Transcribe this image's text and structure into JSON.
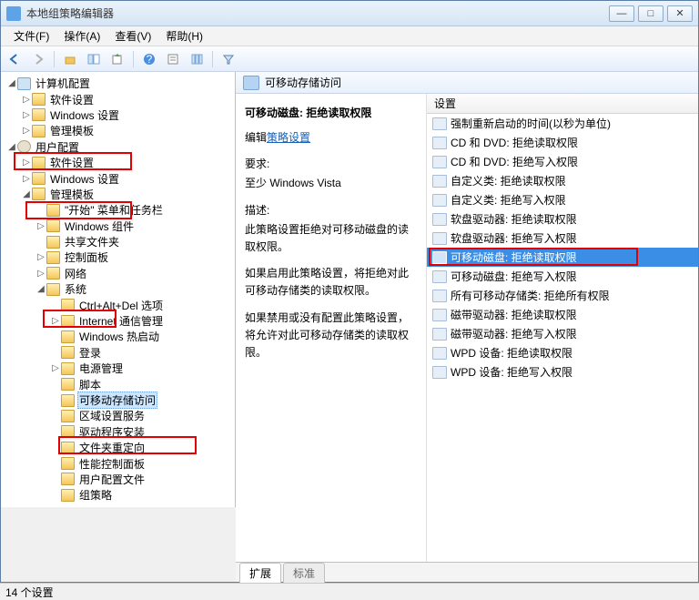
{
  "window": {
    "title": "本地组策略编辑器"
  },
  "menu": {
    "file": "文件(F)",
    "action": "操作(A)",
    "view": "查看(V)",
    "help": "帮助(H)"
  },
  "toolbar_icons": [
    "back",
    "forward",
    "up",
    "show-hide-tree",
    "export",
    "refresh",
    "help",
    "properties",
    "columns",
    "filter"
  ],
  "tree": {
    "root": "计算机配置",
    "n1": "软件设置",
    "n2": "Windows 设置",
    "n3": "管理模板",
    "user_root": "用户配置",
    "u1": "软件设置",
    "u2": "Windows 设置",
    "u3": "管理模板",
    "u3a": "\"开始\" 菜单和任务栏",
    "u3b": "Windows 组件",
    "u3c": "共享文件夹",
    "u3d": "控制面板",
    "u3e": "网络",
    "u3f": "系统",
    "s1": "Ctrl+Alt+Del 选项",
    "s2": "Internet 通信管理",
    "s3": "Windows 热启动",
    "s4": "登录",
    "s5": "电源管理",
    "s6": "脚本",
    "s7": "可移动存储访问",
    "s8": "区域设置服务",
    "s9": "驱动程序安装",
    "s10": "文件夹重定向",
    "s11": "性能控制面板",
    "s12": "用户配置文件",
    "s13": "组策略"
  },
  "pathbar": {
    "title": "可移动存储访问"
  },
  "detail": {
    "title": "可移动磁盘: 拒绝读取权限",
    "edit_label": "编辑",
    "policy_link": "策略设置",
    "req_label": "要求:",
    "req_value": "至少 Windows Vista",
    "desc_label": "描述:",
    "desc1": "此策略设置拒绝对可移动磁盘的读取权限。",
    "desc2": "如果启用此策略设置，将拒绝对此可移动存储类的读取权限。",
    "desc3": "如果禁用或没有配置此策略设置，将允许对此可移动存储类的读取权限。"
  },
  "list": {
    "header": "设置",
    "items": [
      "强制重新启动的时间(以秒为单位)",
      "CD 和 DVD: 拒绝读取权限",
      "CD 和 DVD: 拒绝写入权限",
      "自定义类: 拒绝读取权限",
      "自定义类: 拒绝写入权限",
      "软盘驱动器: 拒绝读取权限",
      "软盘驱动器: 拒绝写入权限",
      "可移动磁盘: 拒绝读取权限",
      "可移动磁盘: 拒绝写入权限",
      "所有可移动存储类: 拒绝所有权限",
      "磁带驱动器: 拒绝读取权限",
      "磁带驱动器: 拒绝写入权限",
      "WPD 设备: 拒绝读取权限",
      "WPD 设备: 拒绝写入权限"
    ],
    "selected_index": 7
  },
  "tabs": {
    "extended": "扩展",
    "standard": "标准"
  },
  "status": {
    "text": "14 个设置"
  }
}
